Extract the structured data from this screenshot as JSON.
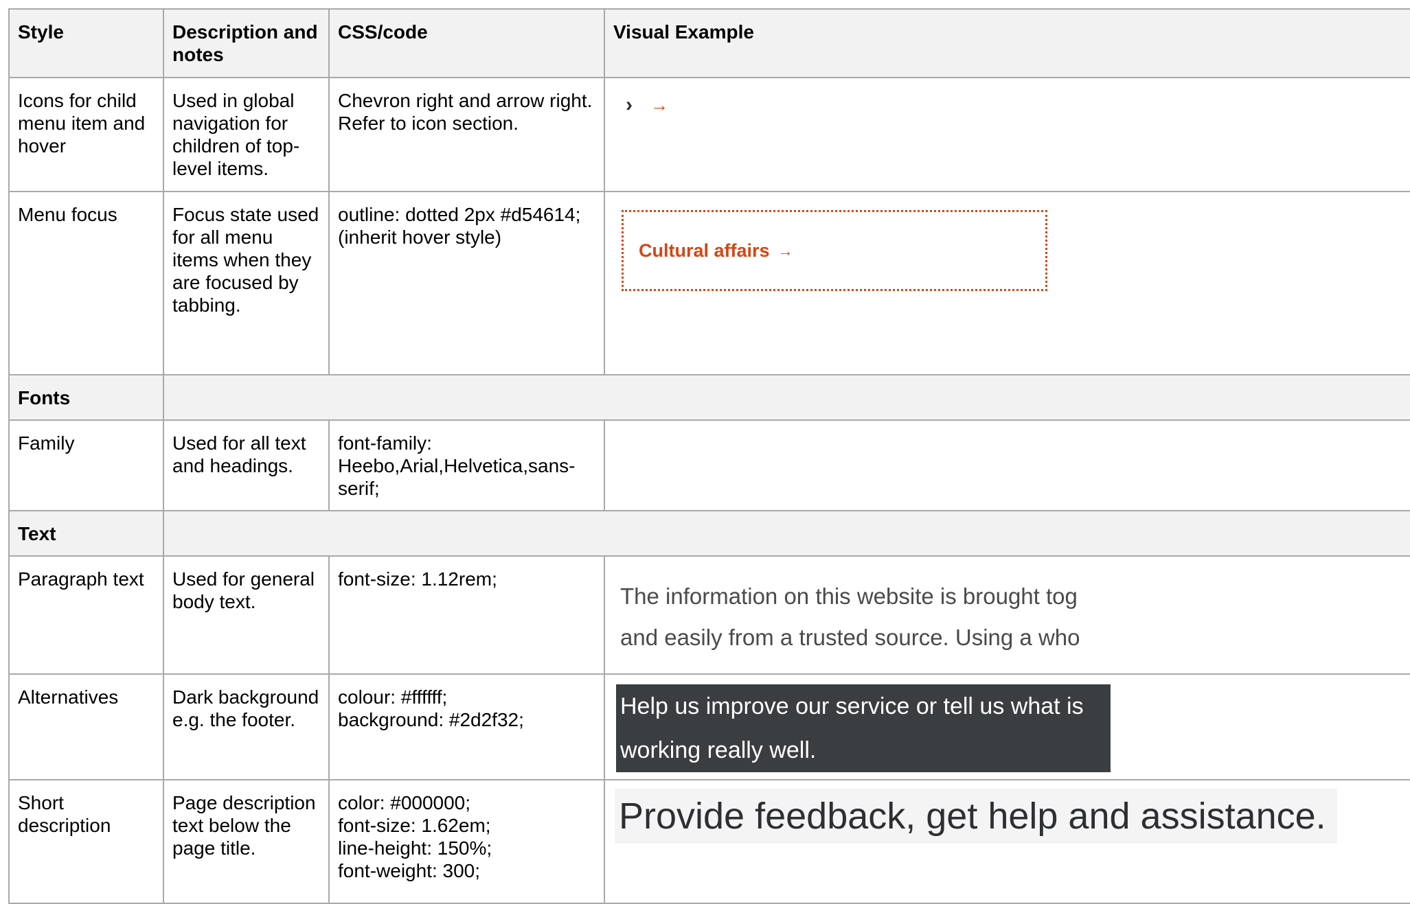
{
  "header": {
    "style": "Style",
    "description": "Description and notes",
    "code": "CSS/code",
    "visual": "Visual Example"
  },
  "rows": {
    "icons": {
      "style": "Icons for child menu item and hover",
      "description": "Used in global navigation for children of top-level items.",
      "code": "Chevron right and arrow right.\nRefer to icon section.",
      "icons": [
        "chevron-right-icon",
        "arrow-right-icon"
      ]
    },
    "focus": {
      "style": "Menu focus",
      "description": "Focus state used for all menu items when they are focused by tabbing.",
      "code": "outline: dotted 2px #d54614;\n(inherit hover style)",
      "example_label": "Cultural affairs",
      "example_arrow": "→",
      "accent_color": "#d54614"
    },
    "fonts_section": "Fonts",
    "family": {
      "style": "Family",
      "description": "Used for all text and headings.",
      "code": "font-family:\nHeebo,Arial,Helvetica,sans-serif;"
    },
    "text_section": "Text",
    "paragraph": {
      "style": "Paragraph text",
      "description": "Used for general body text.",
      "code": "font-size: 1.12rem;",
      "example_line1": "The information on this website is brought tog",
      "example_line2": "and easily from a trusted source.  Using a who"
    },
    "alternatives": {
      "style": "Alternatives",
      "description": "Dark background e.g. the footer.",
      "code": "colour: #ffffff;\nbackground: #2d2f32;",
      "example": "Help us improve our service or tell us what is working really well."
    },
    "short_description": {
      "style": "Short description",
      "description": "Page description text below the page title.",
      "code": "color: #000000;\nfont-size: 1.62em;\nline-height: 150%;\nfont-weight: 300;",
      "example": "Provide feedback, get help and assistance."
    }
  }
}
